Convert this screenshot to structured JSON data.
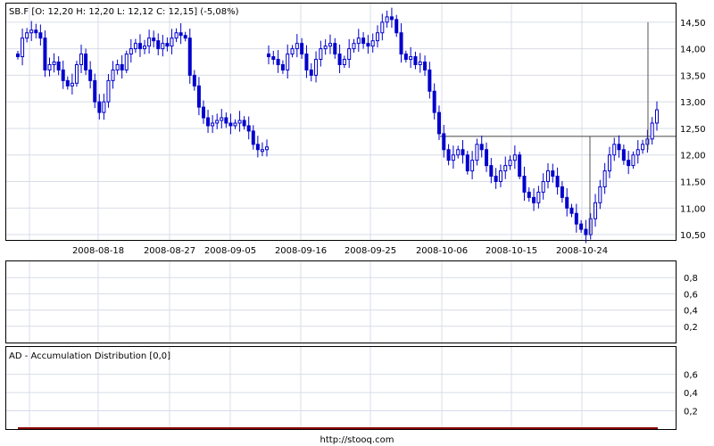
{
  "chart_data": [
    {
      "type": "candlestick",
      "title": "SB.F [O: 12,20  H: 12,20  L: 12,12  C: 12,15] (-5,08%)",
      "x_ticks": [
        "2008-08-18",
        "2008-08-27",
        "2008-09-05",
        "2008-09-16",
        "2008-09-25",
        "2008-10-06",
        "2008-10-15",
        "2008-10-24"
      ],
      "y_ticks": [
        "14,50",
        "14,00",
        "13,50",
        "13,00",
        "12,50",
        "12,00",
        "11,50",
        "11,00",
        "10,50"
      ],
      "ylim": [
        10.4,
        14.85
      ],
      "grid": true,
      "reference_line": 12.35,
      "series": [
        {
          "close": [
            13.85,
            14.2,
            14.3,
            14.35,
            14.3,
            14.2,
            13.6,
            13.7,
            13.75,
            13.6,
            13.4,
            13.3,
            13.35,
            13.7,
            13.9,
            13.6,
            13.4,
            13.0,
            12.8,
            13.0,
            13.4,
            13.6,
            13.7,
            13.6,
            13.9,
            14.0,
            14.1,
            14.0,
            14.05,
            14.2,
            14.15,
            14.0,
            14.1,
            14.05,
            14.2,
            14.3,
            14.25,
            14.2,
            13.5,
            13.3,
            12.9,
            12.7,
            12.55,
            12.6,
            12.65,
            12.7,
            12.6,
            12.55,
            12.6,
            12.65,
            12.55,
            12.45,
            12.2,
            12.1,
            12.1,
            12.15
          ]
        },
        {
          "close": [
            13.85,
            13.8,
            13.7,
            13.6,
            13.9,
            14.0,
            14.1,
            13.9,
            13.6,
            13.5,
            13.8,
            14.0,
            14.05,
            14.1,
            13.9,
            13.7,
            13.8,
            14.0,
            14.1,
            14.2,
            14.1,
            14.05,
            14.15,
            14.3,
            14.5,
            14.6,
            14.55,
            14.3,
            13.9,
            13.8,
            13.85,
            13.7,
            13.75,
            13.6,
            13.2,
            12.8,
            12.4,
            12.1,
            11.9,
            12.0,
            12.1,
            12.0,
            11.7,
            11.9,
            12.2,
            12.1,
            11.8,
            11.6,
            11.5,
            11.7,
            11.8,
            11.9,
            12.0,
            11.6,
            11.3,
            11.2,
            11.1,
            11.3,
            11.5,
            11.7,
            11.6,
            11.4,
            11.2,
            11.0,
            10.9,
            10.7,
            10.6,
            10.5,
            10.8,
            11.1,
            11.4,
            11.7,
            12.0,
            12.2,
            12.1,
            11.9,
            11.8,
            12.0,
            12.1,
            12.2,
            12.3,
            12.6,
            12.85
          ]
        }
      ]
    },
    {
      "type": "line",
      "title": "",
      "y_ticks": [
        "0,8",
        "0,6",
        "0,4",
        "0,2"
      ],
      "ylim": [
        0,
        1
      ]
    },
    {
      "type": "line",
      "title": "AD - Accumulation Distribution [0,0]",
      "y_ticks": [
        "0,6",
        "0,4",
        "0,2"
      ],
      "ylim": [
        0,
        0.9
      ],
      "series": [
        {
          "values": [
            0
          ]
        }
      ]
    }
  ],
  "footer": {
    "link": "http://stooq.com"
  },
  "colors": {
    "candle": "#0000cc",
    "grid": "#d8dce8",
    "frame": "#000000",
    "ad_line": "#8b0000"
  }
}
